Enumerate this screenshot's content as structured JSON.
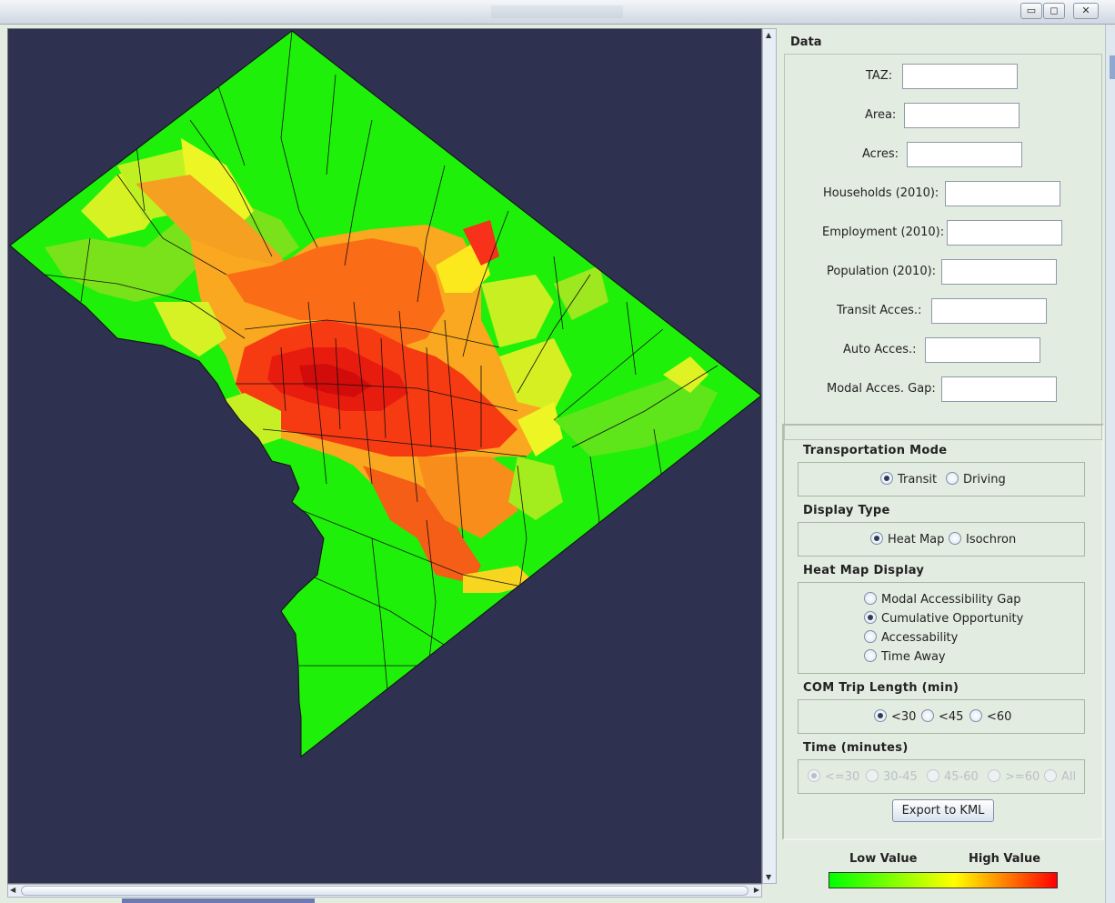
{
  "window": {
    "minimize_icon": "minimize-icon",
    "maximize_icon": "maximize-icon",
    "close_icon": "close-icon",
    "minimize_glyph": "▭",
    "maximize_glyph": "◻",
    "close_glyph": "✕"
  },
  "colors": {
    "map_background": "#2e3150",
    "panel_background": "#e3ece1",
    "low": "#00ff00",
    "mid": "#ffff00",
    "high": "#ff0000"
  },
  "data_panel": {
    "title": "Data",
    "fields": [
      {
        "label": "TAZ:",
        "value": ""
      },
      {
        "label": "Area:",
        "value": ""
      },
      {
        "label": "Acres:",
        "value": ""
      },
      {
        "label": "Households (2010):",
        "value": ""
      },
      {
        "label": "Employment (2010):",
        "value": ""
      },
      {
        "label": "Population (2010):",
        "value": ""
      },
      {
        "label": "Transit Acces.:",
        "value": ""
      },
      {
        "label": "Auto Acces.:",
        "value": ""
      },
      {
        "label": "Modal Acces. Gap:",
        "value": ""
      }
    ]
  },
  "controls": {
    "transport_mode": {
      "title": "Transportation Mode",
      "options": [
        "Transit",
        "Driving"
      ],
      "selected": "Transit"
    },
    "display_type": {
      "title": "Display Type",
      "options": [
        "Heat Map",
        "Isochron"
      ],
      "selected": "Heat Map"
    },
    "heat_map_display": {
      "title": "Heat Map Display",
      "options": [
        "Modal Accessibility Gap",
        "Cumulative Opportunity",
        "Accessability",
        "Time Away"
      ],
      "selected": "Cumulative Opportunity"
    },
    "com_trip_length": {
      "title": "COM Trip Length (min)",
      "options": [
        "<30",
        "<45",
        "<60"
      ],
      "selected": "<30"
    },
    "time_minutes": {
      "title": "Time (minutes)",
      "options": [
        "<=30",
        "30-45",
        "45-60",
        ">=60",
        "All"
      ],
      "selected": "<=30",
      "enabled": false
    },
    "export_label": "Export to KML"
  },
  "legend": {
    "low_label": "Low Value",
    "high_label": "High Value"
  },
  "scroll": {
    "up_glyph": "▲",
    "down_glyph": "▼",
    "left_glyph": "◀",
    "right_glyph": "▶"
  }
}
